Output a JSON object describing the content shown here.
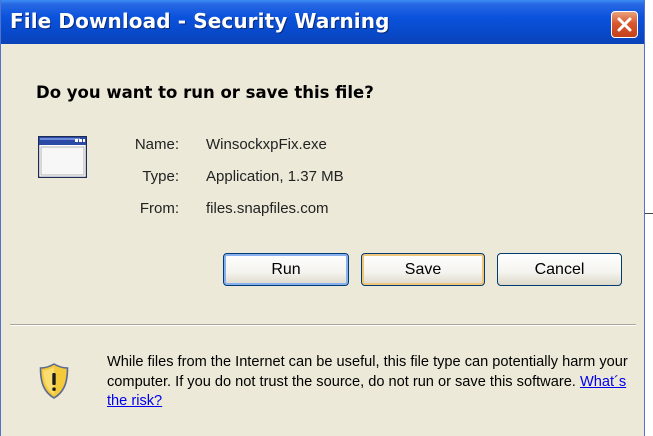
{
  "window": {
    "title": "File Download - Security Warning",
    "close_icon": "close-icon",
    "colors": {
      "titlebar": "#0a52dc",
      "body": "#ece9d8",
      "close": "#d9582f",
      "link": "#0000ee"
    }
  },
  "dialog": {
    "question": "Do you want to run or save this file?",
    "file_icon": "application-window-icon",
    "fields": [
      {
        "label": "Name:",
        "value": "WinsockxpFix.exe"
      },
      {
        "label": "Type:",
        "value": "Application, 1.37 MB"
      },
      {
        "label": "From:",
        "value": "files.snapfiles.com"
      }
    ],
    "buttons": {
      "run": "Run",
      "save": "Save",
      "cancel": "Cancel"
    }
  },
  "warning": {
    "icon": "shield-warning-icon",
    "text": "While files from the Internet can be useful, this file type can potentially harm your computer. If you do not trust the source, do not run or save this software.",
    "link": "What´s the risk?"
  }
}
